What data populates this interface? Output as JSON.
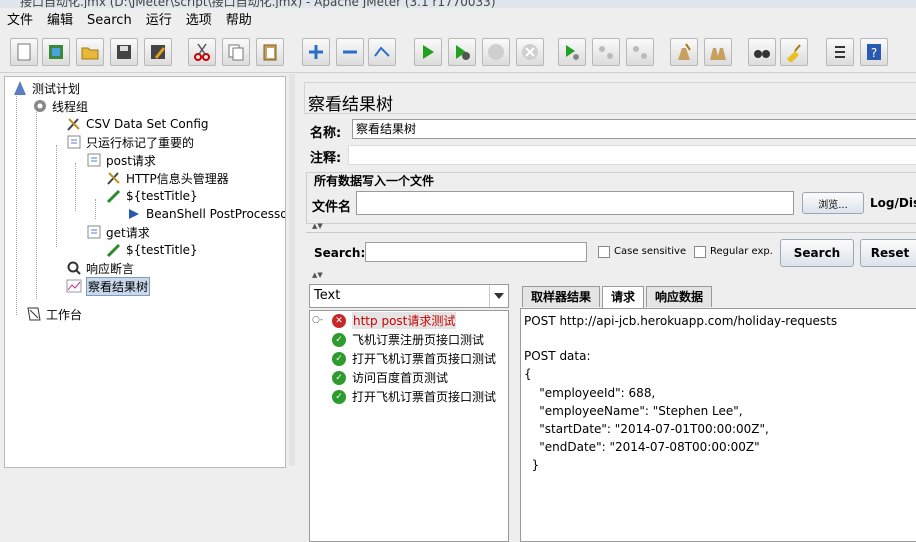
{
  "window": {
    "title": "接口自动化.jmx (D:\\JMeter\\script\\接口自动化.jmx) - Apache JMeter (3.1 r1770033)"
  },
  "menu": [
    "文件",
    "编辑",
    "Search",
    "运行",
    "选项",
    "帮助"
  ],
  "toolbar": {
    "icons": [
      "new-icon",
      "templates-icon",
      "open-icon",
      "save-icon",
      "save-as-icon",
      "cut-icon",
      "copy-icon",
      "paste-icon",
      "expand-icon",
      "collapse-icon",
      "toggle-icon",
      "start-icon",
      "start-no-pause-icon",
      "stop-icon",
      "shutdown-icon",
      "remote-start-icon",
      "remote-stop-icon",
      "remote-shutdown-icon",
      "clear-icon",
      "clear-all-icon",
      "search-icon",
      "reset-search-icon",
      "function-helper-icon",
      "help-icon"
    ]
  },
  "tree": {
    "nodes": [
      {
        "label": "测试计划",
        "icon": "test-plan-icon"
      },
      {
        "label": "线程组",
        "icon": "thread-group-icon"
      },
      {
        "label": "CSV Data Set Config",
        "icon": "config-element-icon"
      },
      {
        "label": "只运行标记了重要的",
        "icon": "controller-icon"
      },
      {
        "label": "post请求",
        "icon": "controller-icon"
      },
      {
        "label": "HTTP信息头管理器",
        "icon": "config-element-icon"
      },
      {
        "label": "${testTitle}",
        "icon": "sampler-icon"
      },
      {
        "label": "BeanShell PostProcessor",
        "icon": "post-processor-icon"
      },
      {
        "label": "get请求",
        "icon": "controller-icon"
      },
      {
        "label": "${testTitle}",
        "icon": "sampler-icon"
      },
      {
        "label": "响应断言",
        "icon": "assertion-icon"
      },
      {
        "label": "察看结果树",
        "icon": "listener-icon"
      },
      {
        "label": "工作台",
        "icon": "workbench-icon"
      }
    ]
  },
  "panel": {
    "title": "察看结果树",
    "name_label": "名称:",
    "name_value": "察看结果树",
    "comment_label": "注释:",
    "comment_value": "",
    "file_group_title": "所有数据写入一个文件",
    "filename_label": "文件名",
    "filename_value": "",
    "browse_label": "浏览...",
    "log_label": "Log/Disp"
  },
  "search": {
    "label": "Search:",
    "value": "",
    "case_label": "Case sensitive",
    "regex_label": "Regular exp.",
    "search_button": "Search",
    "reset_button": "Reset"
  },
  "results": {
    "renderer": "Text",
    "items": [
      {
        "label": "http post请求测试",
        "status": "failed"
      },
      {
        "label": "飞机订票注册页接口测试",
        "status": "passed"
      },
      {
        "label": "打开飞机订票首页接口测试",
        "status": "passed"
      },
      {
        "label": "访问百度首页测试",
        "status": "passed"
      },
      {
        "label": "打开飞机订票首页接口测试",
        "status": "passed"
      }
    ]
  },
  "tabs": [
    "取样器结果",
    "请求",
    "响应数据"
  ],
  "active_tab": "请求",
  "request_lines": [
    "POST http://api-jcb.herokuapp.com/holiday-requests",
    "",
    "POST data:",
    "{",
    "    \"employeeId\": 688,",
    "    \"employeeName\": \"Stephen Lee\",",
    "    \"startDate\": \"2014-07-01T00:00:00Z\",",
    "    \"endDate\": \"2014-07-08T00:00:00Z\"",
    "  }"
  ],
  "colors": {
    "error": "#cc0000",
    "passed": "#2e9b2e",
    "failed": "#c62828",
    "selection": "#c9d8ec"
  }
}
